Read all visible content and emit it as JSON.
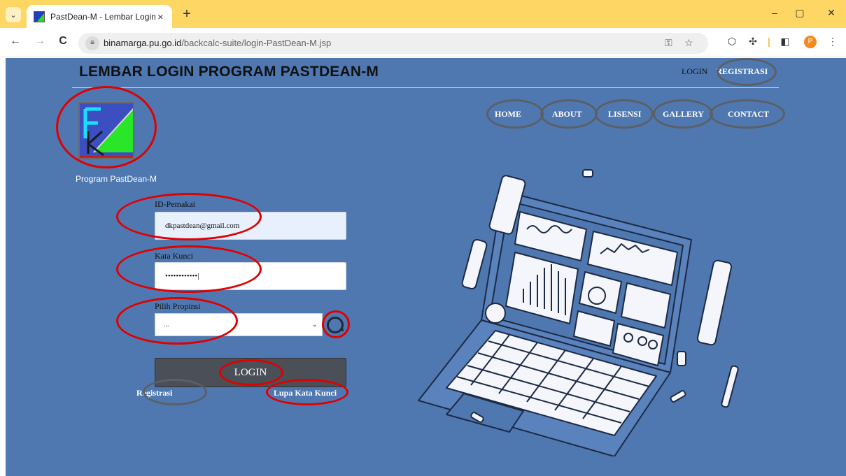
{
  "browser": {
    "tab_title": "PastDean-M - Lembar Login",
    "tab_close": "×",
    "new_tab": "+",
    "url_host": "binamarga.pu.go.id",
    "url_path": "/backcalc-suite/login-PastDean-M.jsp",
    "profile_initial": "P",
    "window_controls": {
      "minimize": "–",
      "maximize": "▢",
      "close": "✕"
    },
    "nav": {
      "back": "←",
      "forward": "→",
      "reload": "C"
    }
  },
  "header": {
    "title": "LEMBAR LOGIN PROGRAM PASTDEAN-M",
    "links": [
      {
        "label": "LOGIN"
      },
      {
        "label": "REGISTRASI"
      }
    ]
  },
  "logo": {
    "caption": "Program PastDean-M"
  },
  "main_nav": [
    {
      "label": "HOME"
    },
    {
      "label": "ABOUT"
    },
    {
      "label": "LISENSI"
    },
    {
      "label": "GALLERY"
    },
    {
      "label": "CONTACT"
    }
  ],
  "form": {
    "user_label": "ID-Pemakai",
    "user_value": "dkpastdean@gmail.com",
    "password_label": "Kata Kunci",
    "password_value": "••••••••••••|",
    "province_label": "Pilih Propinsi",
    "province_value": "...",
    "login_button": "LOGIN",
    "register_link": "Registrasi",
    "forgot_link": "Lupa Kata Kunci"
  },
  "colors": {
    "page_bg": "#4f78b1",
    "tabbar_bg": "#fdd663",
    "annotation_red": "#e00000",
    "annotation_grey": "#5b5f66"
  },
  "icons": {
    "tab_menu": "chevron-down-icon",
    "site_info": "tune-icon",
    "key": "key-icon",
    "star": "star-icon",
    "extensions": "puzzle-icon",
    "sidebar": "side-panel-icon",
    "menu": "kebab-menu-icon",
    "refresh": "refresh-icon",
    "illustration": "laptop-dashboard-illustration"
  }
}
